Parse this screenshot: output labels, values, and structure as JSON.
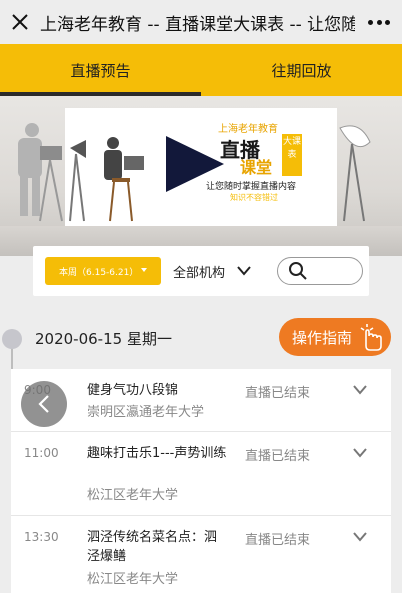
{
  "titlebar": {
    "title": "上海老年教育 -- 直播课堂大课表 -- 让您随时掌握直播内容"
  },
  "tabs": [
    {
      "label": "直播预告",
      "active": true
    },
    {
      "label": "往期回放",
      "active": false
    }
  ],
  "banner": {
    "brand_top": "上海老年教育",
    "brand_big": "直播",
    "brand_big2": "课堂",
    "brand_side": "大课表",
    "slogan": "让您随时掌握直播内容",
    "slogan2": "知识不容错过"
  },
  "filter": {
    "week_label": "本周（6.15-6.21）",
    "org_label": "全部机构",
    "search_placeholder": ""
  },
  "schedule": {
    "date": "2020-06-15  星期一",
    "guide_label": "操作指南",
    "items": [
      {
        "time": "9:00",
        "course": "健身气功八段锦",
        "org": "崇明区瀛通老年大学",
        "status": "直播已结束"
      },
      {
        "time": "11:00",
        "course": "趣味打击乐1---声势训练",
        "org": "松江区老年大学",
        "status": "直播已结束"
      },
      {
        "time": "13:30",
        "course": "泗泾传统名菜名点：泗泾爆鳝",
        "org": "松江区老年大学",
        "status": "直播已结束"
      }
    ]
  },
  "colors": {
    "accent": "#f5bd07",
    "guide": "#ee7a22"
  }
}
